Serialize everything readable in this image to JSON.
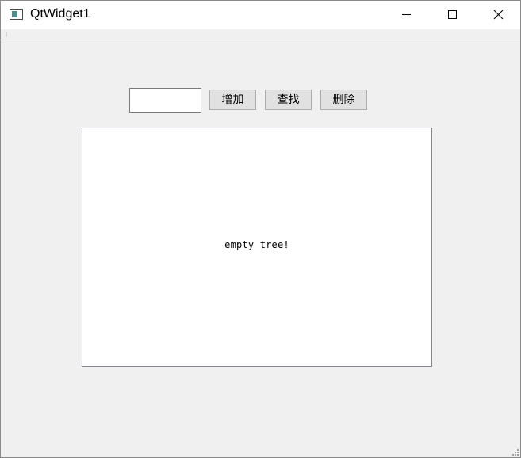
{
  "window": {
    "title": "QtWidget1"
  },
  "icons": {
    "app": "app-window-icon",
    "minimize": "minimize-icon",
    "maximize": "maximize-icon",
    "close": "close-icon",
    "toolbar_grip": "toolbar-grip-icon",
    "size_grip": "size-grip-icon"
  },
  "controls": {
    "input_value": "",
    "add_label": "增加",
    "find_label": "查找",
    "delete_label": "删除"
  },
  "tree": {
    "empty_message": "empty tree!"
  },
  "colors": {
    "window_bg": "#f0f0f0",
    "button_bg": "#e1e1e1",
    "button_border": "#adadad",
    "tree_border": "#828790"
  }
}
